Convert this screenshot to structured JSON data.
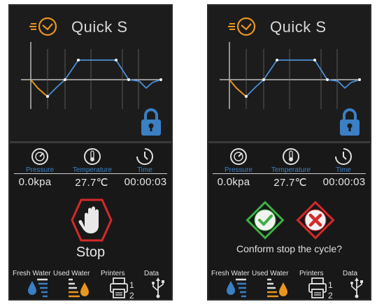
{
  "colors": {
    "accent_blue": "#3b7fc4",
    "accent_orange": "#e8961e",
    "line_blue": "#4a8fd6",
    "stop_red": "#d6282a",
    "ok_green": "#3cb043"
  },
  "screens": [
    {
      "program_icon": "clock-program-icon",
      "program_name": "Quick S",
      "lock_icon": "padlock-icon",
      "sensors": [
        {
          "icon": "gauge-icon",
          "label": "Pressure",
          "value": "0.0kpa"
        },
        {
          "icon": "thermometer-icon",
          "label": "Temperature",
          "value": "27.7℃"
        },
        {
          "icon": "clock-icon",
          "label": "Time",
          "value": "00:00:03"
        }
      ],
      "stop_label": "Stop",
      "bottom": [
        {
          "label": "Fresh Water",
          "icon": "fresh-water-icon"
        },
        {
          "label": "Used Water",
          "icon": "used-water-icon"
        },
        {
          "label": "Printers",
          "icon": "printer-icon",
          "numbers": [
            "1",
            "2"
          ]
        },
        {
          "label": "Data",
          "icon": "usb-icon"
        }
      ]
    },
    {
      "program_icon": "clock-program-icon",
      "program_name": "Quick S",
      "lock_icon": "padlock-icon",
      "sensors": [
        {
          "icon": "gauge-icon",
          "label": "Pressure",
          "value": "0.0kpa"
        },
        {
          "icon": "thermometer-icon",
          "label": "Temperature",
          "value": "27.7℃"
        },
        {
          "icon": "clock-icon",
          "label": "Time",
          "value": "00:00:03"
        }
      ],
      "confirm_text": "Conform stop the cycle?",
      "bottom": [
        {
          "label": "Fresh Water",
          "icon": "fresh-water-icon"
        },
        {
          "label": "Used Water",
          "icon": "used-water-icon"
        },
        {
          "label": "Printers",
          "icon": "printer-icon",
          "numbers": [
            "1",
            "2"
          ]
        },
        {
          "label": "Data",
          "icon": "usb-icon"
        }
      ]
    }
  ]
}
